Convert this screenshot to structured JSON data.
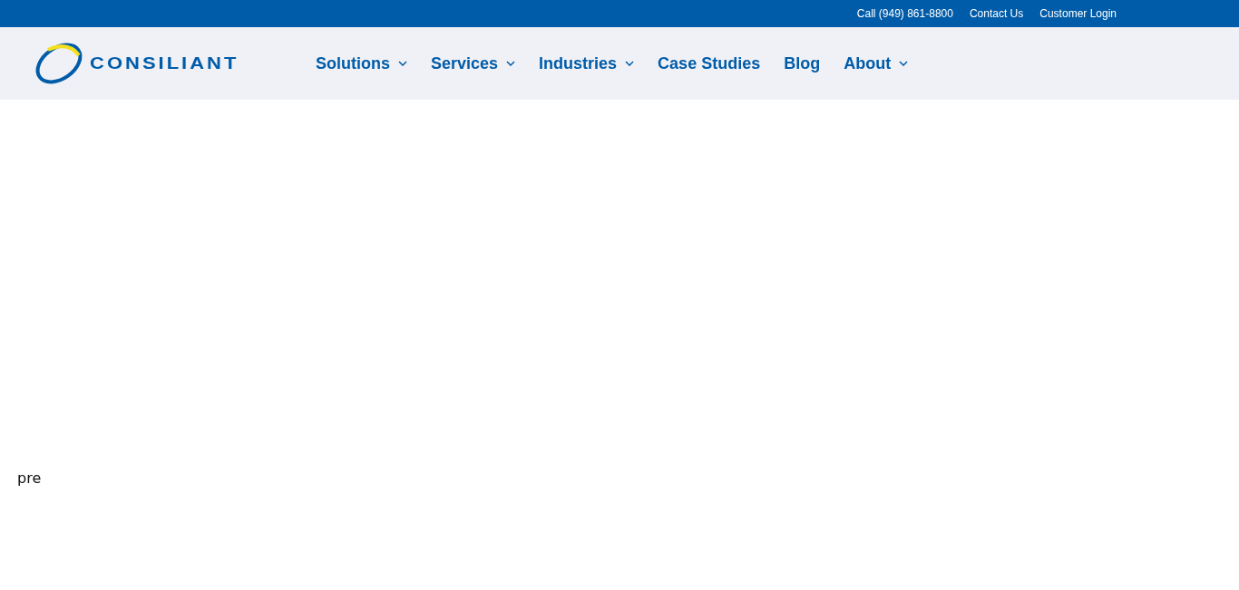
{
  "top_bar": {
    "links": [
      "Call (949) 861-8800",
      "Contact Us",
      "Customer Login"
    ]
  },
  "header": {
    "logo": "CONSILIANT",
    "nav": [
      {
        "label": "Solutions",
        "has_dropdown": true
      },
      {
        "label": "Services",
        "has_dropdown": true
      },
      {
        "label": "Industries",
        "has_dropdown": true
      },
      {
        "label": "Case Studies",
        "has_dropdown": false
      },
      {
        "label": "Blog",
        "has_dropdown": false
      },
      {
        "label": "About",
        "has_dropdown": true
      }
    ]
  },
  "content": {
    "text": "pre"
  }
}
